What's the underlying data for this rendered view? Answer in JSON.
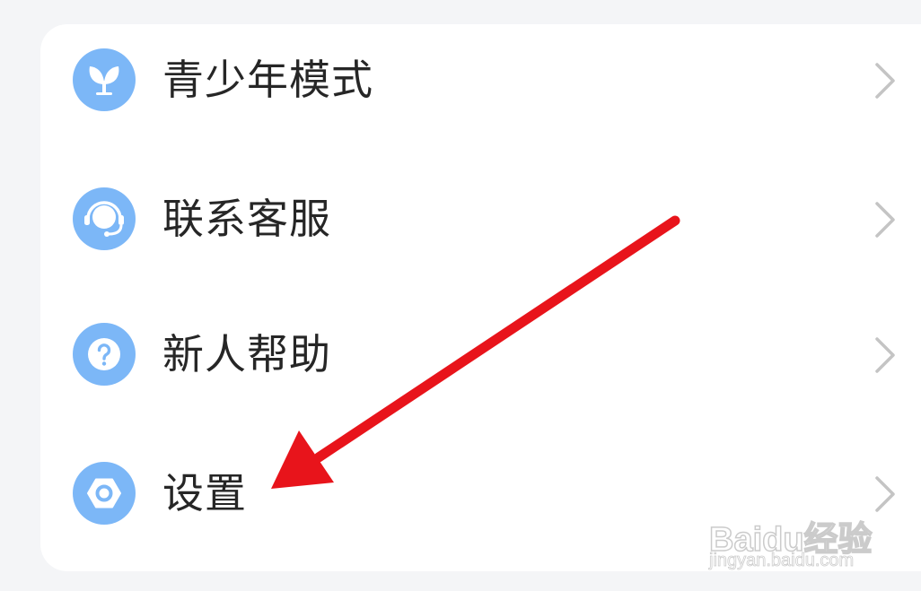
{
  "menu": {
    "items": [
      {
        "label": "青少年模式",
        "icon": "sprout-icon"
      },
      {
        "label": "联系客服",
        "icon": "headset-icon"
      },
      {
        "label": "新人帮助",
        "icon": "question-icon"
      },
      {
        "label": "设置",
        "icon": "hex-nut-icon"
      }
    ]
  },
  "colors": {
    "icon_bg": "#7cb7f7",
    "label": "#262626",
    "chevron": "#c4c4c4",
    "arrow": "#e8141b",
    "background": "#f4f5f7",
    "card": "#ffffff"
  },
  "watermark": {
    "brand": "Baidu经验",
    "url": "jingyan.baidu.com"
  }
}
